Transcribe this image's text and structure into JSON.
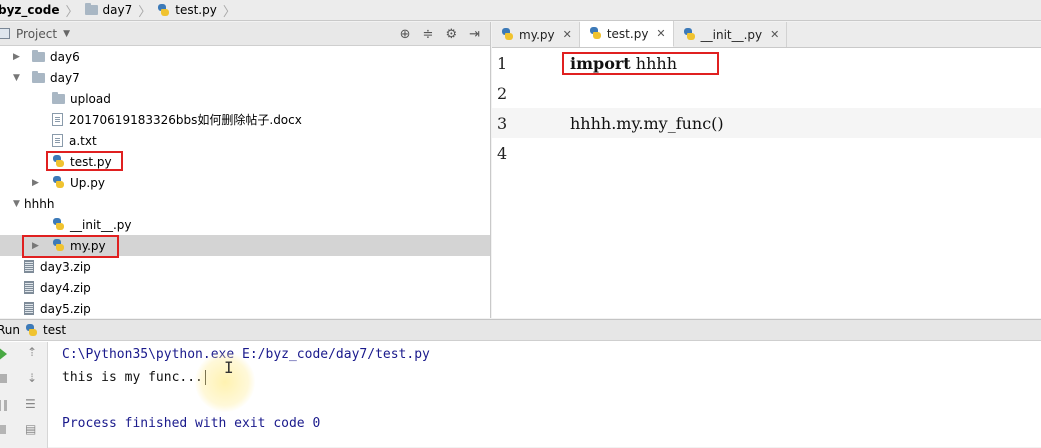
{
  "breadcrumbs": [
    {
      "label": "byz_code",
      "icon": "folder-icon"
    },
    {
      "label": "day7",
      "icon": "folder-icon"
    },
    {
      "label": "test.py",
      "icon": "python-file-icon"
    }
  ],
  "project": {
    "title": "Project",
    "tree": [
      {
        "label": "day6",
        "type": "folder",
        "level": 0,
        "expanded": false
      },
      {
        "label": "day7",
        "type": "folder",
        "level": 0,
        "expanded": true
      },
      {
        "label": "upload",
        "type": "folder",
        "level": 1
      },
      {
        "label": "20170619183326bbs如何删除帖子.docx",
        "type": "file",
        "level": 1
      },
      {
        "label": "a.txt",
        "type": "file",
        "level": 1
      },
      {
        "label": "test.py",
        "type": "python",
        "level": 1
      },
      {
        "label": "Up.py",
        "type": "python",
        "level": 1,
        "expandable": true
      },
      {
        "label": "hhhh",
        "type": "folder",
        "level": 0,
        "expanded": true
      },
      {
        "label": "__init__.py",
        "type": "python",
        "level": 1
      },
      {
        "label": "my.py",
        "type": "python",
        "level": 1,
        "expandable": true,
        "selected": true
      },
      {
        "label": "day3.zip",
        "type": "zip",
        "level": 0
      },
      {
        "label": "day4.zip",
        "type": "zip",
        "level": 0
      },
      {
        "label": "day5.zip",
        "type": "zip",
        "level": 0
      }
    ]
  },
  "editor": {
    "tabs": [
      {
        "label": "my.py",
        "active": false
      },
      {
        "label": "test.py",
        "active": true
      },
      {
        "label": "__init__.py",
        "active": false
      }
    ],
    "lines": [
      {
        "num": "1",
        "keyword": "import",
        "rest": " hhhh"
      },
      {
        "num": "2",
        "keyword": "",
        "rest": ""
      },
      {
        "num": "3",
        "keyword": "",
        "rest": "hhhh.my.my_func()"
      },
      {
        "num": "4",
        "keyword": "",
        "rest": ""
      }
    ]
  },
  "run": {
    "label": "Run",
    "config": "test",
    "output": [
      "C:\\Python35\\python.exe E:/byz_code/day7/test.py",
      "this is my func...",
      "",
      "Process finished with exit code 0"
    ]
  },
  "colors": {
    "highlight_box": "#e02020",
    "run_green": "#48a843"
  }
}
